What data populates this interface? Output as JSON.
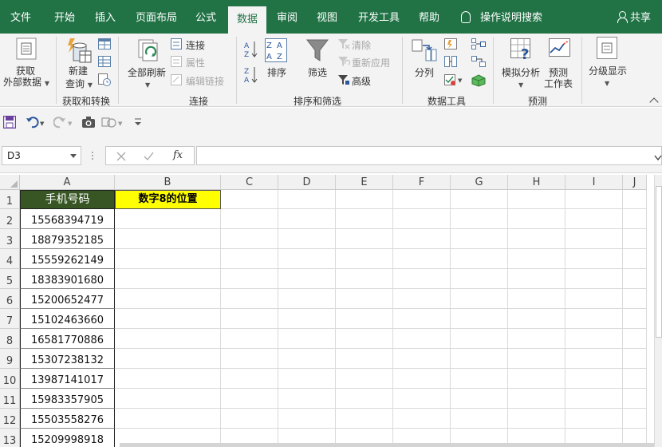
{
  "tabs": [
    {
      "label": "文件",
      "active": false
    },
    {
      "label": "开始",
      "active": false
    },
    {
      "label": "插入",
      "active": false
    },
    {
      "label": "页面布局",
      "active": false
    },
    {
      "label": "公式",
      "active": false
    },
    {
      "label": "数据",
      "active": true
    },
    {
      "label": "审阅",
      "active": false
    },
    {
      "label": "视图",
      "active": false
    },
    {
      "label": "开发工具",
      "active": false
    },
    {
      "label": "帮助",
      "active": false
    }
  ],
  "tell_me": "操作说明搜索",
  "share": "共享",
  "colors": {
    "ribbon_green": "#217346",
    "header_dark_green": "#375623",
    "highlight_yellow": "#ffff00"
  },
  "ribbon": {
    "get_transform": {
      "group_label": "获取和转换",
      "get_external_line1": "获取",
      "get_external_line2": "外部数据",
      "new_query_line1": "新建",
      "new_query_line2": "查询"
    },
    "connections": {
      "group_label": "连接",
      "refresh_all": "全部刷新",
      "connections": "连接",
      "properties": "属性",
      "edit_links": "编辑链接"
    },
    "sort_filter": {
      "group_label": "排序和筛选",
      "sort": "排序",
      "filter": "筛选",
      "clear": "清除",
      "reapply": "重新应用",
      "advanced": "高级"
    },
    "data_tools": {
      "group_label": "数据工具",
      "text_to_columns": "分列"
    },
    "forecast": {
      "group_label": "预测",
      "what_if": "模拟分析",
      "forecast_sheet_line1": "预测",
      "forecast_sheet_line2": "工作表"
    },
    "outline": {
      "outline": "分级显示"
    }
  },
  "qat": {
    "icons": [
      "save-icon",
      "undo-icon",
      "redo-icon",
      "camera-icon",
      "shapes-icon",
      "customize-icon"
    ]
  },
  "formula_bar": {
    "name_box": "D3",
    "fx": "fx",
    "formula": ""
  },
  "sheet": {
    "columns": [
      "A",
      "B",
      "C",
      "D",
      "E",
      "F",
      "G",
      "H",
      "I",
      "J"
    ],
    "rows": [
      "1",
      "2",
      "3",
      "4",
      "5",
      "6",
      "7",
      "8",
      "9",
      "10",
      "11",
      "12",
      "13"
    ],
    "header_A": "手机号码",
    "header_B": "数字8的位置",
    "phone_numbers": [
      "15568394719",
      "18879352185",
      "15559262149",
      "18383901680",
      "15200652477",
      "15102463660",
      "16581770886",
      "15307238132",
      "13987141017",
      "15983357905",
      "15503558276",
      "15209998918"
    ]
  }
}
